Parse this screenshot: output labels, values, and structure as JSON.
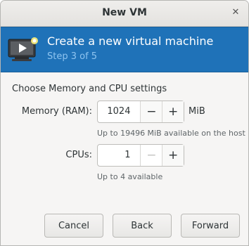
{
  "window": {
    "title": "New VM",
    "close_icon": "close-icon"
  },
  "banner": {
    "title": "Create a new virtual machine",
    "step": "Step 3 of 5",
    "icon": "vm-monitor-icon",
    "bg": "#1f72b8"
  },
  "section_title": "Choose Memory and CPU settings",
  "memory": {
    "label": "Memory (RAM):",
    "value": "1024",
    "minus": "−",
    "plus": "+",
    "unit": "MiB",
    "hint": "Up to 19496 MiB available on the host"
  },
  "cpus": {
    "label": "CPUs:",
    "value": "1",
    "minus": "−",
    "plus": "+",
    "hint": "Up to 4 available"
  },
  "buttons": {
    "cancel": "Cancel",
    "back": "Back",
    "forward": "Forward"
  }
}
